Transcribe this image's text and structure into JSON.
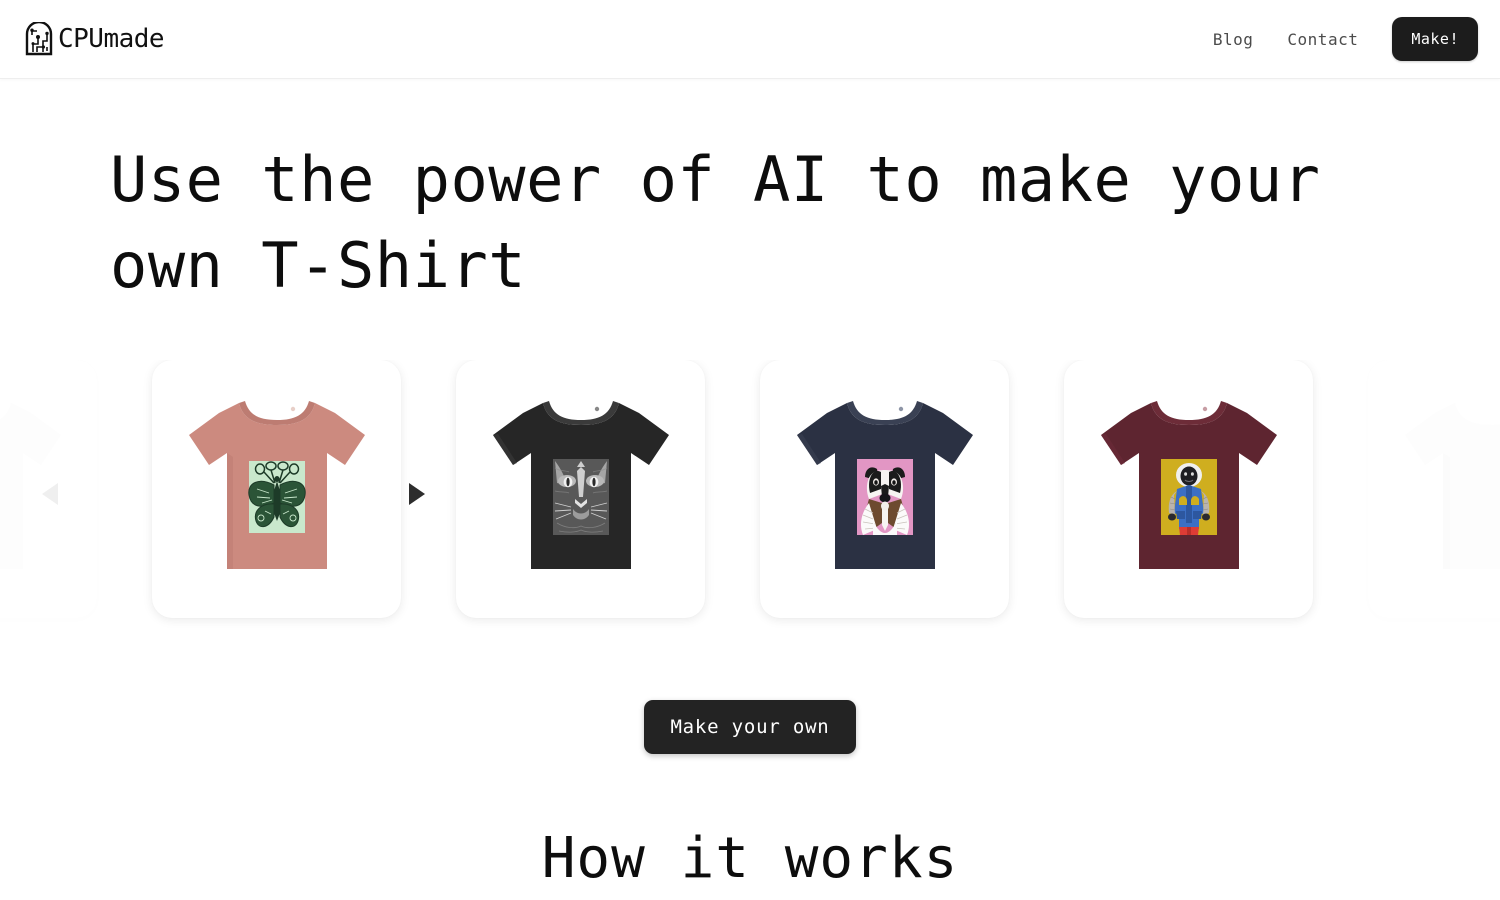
{
  "header": {
    "brand_name": "CPUmade",
    "brand_icon": "cpu-chip-fingerprint-icon",
    "nav": [
      {
        "label": "Blog",
        "name": "nav-link-blog"
      },
      {
        "label": "Contact",
        "name": "nav-link-contact"
      }
    ],
    "cta_label": "Make!"
  },
  "hero": {
    "title": "Use the power of AI to make your own T-Shirt",
    "cta_label": "Make your own"
  },
  "carousel": {
    "prev_icon": "chevron-left-icon",
    "next_icon": "chevron-right-icon",
    "items": [
      {
        "name": "shirt-card-partial-left",
        "shirt_color": "#f3f3f3",
        "shirt_shade": "#e8e8e8",
        "print_bg": "#efefef",
        "print_label": "",
        "design": "hidden-partial",
        "partial": true
      },
      {
        "name": "shirt-card-butterfly",
        "shirt_color": "#cc8a7f",
        "shirt_shade": "#bd7c72",
        "print_bg": "#c9e8cc",
        "print_label": "butterfly mandala",
        "design": "butterfly",
        "ink": "#1d3b28",
        "partial": false
      },
      {
        "name": "shirt-card-cat",
        "shirt_color": "#262626",
        "shirt_shade": "#1a1a1a",
        "print_bg": "#9a9a9a",
        "print_label": "cat face",
        "design": "cat",
        "ink": "#d8d8d8",
        "partial": false
      },
      {
        "name": "shirt-card-dog",
        "shirt_color": "#2b3143",
        "shirt_shade": "#222636",
        "print_bg": "#e296c4",
        "print_label": "border collie dog",
        "design": "dog",
        "ink": "#1b1b1b",
        "partial": false
      },
      {
        "name": "shirt-card-monkey",
        "shirt_color": "#5e2530",
        "shirt_shade": "#4e1e28",
        "print_bg": "#cfae1f",
        "print_label": "monkey in blue vest",
        "design": "monkey",
        "ink": "#3b6fc4",
        "partial": false
      },
      {
        "name": "shirt-card-partial-right",
        "shirt_color": "#f4f4f4",
        "shirt_shade": "#ededed",
        "print_bg": "#f0f0f0",
        "print_label": "",
        "design": "plain",
        "partial": true
      }
    ]
  },
  "how_it_works": {
    "heading": "How it works"
  },
  "colors": {
    "page_bg": "#ffffff",
    "text": "#0d0d0d",
    "button_dark": "#1c1c1c",
    "nav_text": "#4b4b4b"
  }
}
